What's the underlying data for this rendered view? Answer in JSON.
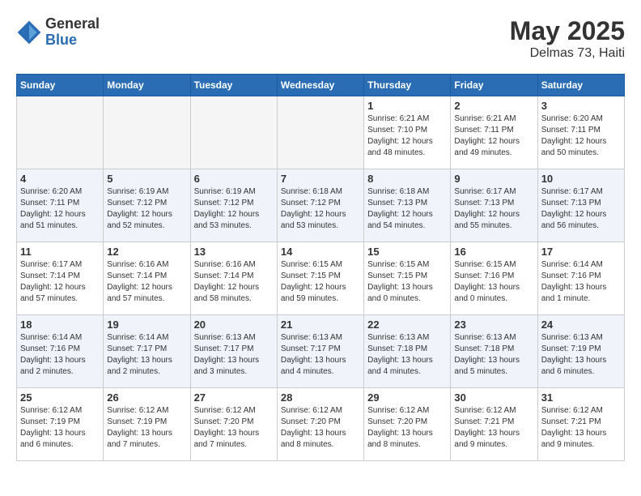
{
  "header": {
    "logo_general": "General",
    "logo_blue": "Blue",
    "title": "May 2025",
    "location": "Delmas 73, Haiti"
  },
  "weekdays": [
    "Sunday",
    "Monday",
    "Tuesday",
    "Wednesday",
    "Thursday",
    "Friday",
    "Saturday"
  ],
  "weeks": [
    [
      {
        "day": "",
        "sunrise": "",
        "sunset": "",
        "daylight": "",
        "empty": true
      },
      {
        "day": "",
        "sunrise": "",
        "sunset": "",
        "daylight": "",
        "empty": true
      },
      {
        "day": "",
        "sunrise": "",
        "sunset": "",
        "daylight": "",
        "empty": true
      },
      {
        "day": "",
        "sunrise": "",
        "sunset": "",
        "daylight": "",
        "empty": true
      },
      {
        "day": "1",
        "sunrise": "Sunrise: 6:21 AM",
        "sunset": "Sunset: 7:10 PM",
        "daylight": "Daylight: 12 hours and 48 minutes.",
        "empty": false
      },
      {
        "day": "2",
        "sunrise": "Sunrise: 6:21 AM",
        "sunset": "Sunset: 7:11 PM",
        "daylight": "Daylight: 12 hours and 49 minutes.",
        "empty": false
      },
      {
        "day": "3",
        "sunrise": "Sunrise: 6:20 AM",
        "sunset": "Sunset: 7:11 PM",
        "daylight": "Daylight: 12 hours and 50 minutes.",
        "empty": false
      }
    ],
    [
      {
        "day": "4",
        "sunrise": "Sunrise: 6:20 AM",
        "sunset": "Sunset: 7:11 PM",
        "daylight": "Daylight: 12 hours and 51 minutes.",
        "empty": false
      },
      {
        "day": "5",
        "sunrise": "Sunrise: 6:19 AM",
        "sunset": "Sunset: 7:12 PM",
        "daylight": "Daylight: 12 hours and 52 minutes.",
        "empty": false
      },
      {
        "day": "6",
        "sunrise": "Sunrise: 6:19 AM",
        "sunset": "Sunset: 7:12 PM",
        "daylight": "Daylight: 12 hours and 53 minutes.",
        "empty": false
      },
      {
        "day": "7",
        "sunrise": "Sunrise: 6:18 AM",
        "sunset": "Sunset: 7:12 PM",
        "daylight": "Daylight: 12 hours and 53 minutes.",
        "empty": false
      },
      {
        "day": "8",
        "sunrise": "Sunrise: 6:18 AM",
        "sunset": "Sunset: 7:13 PM",
        "daylight": "Daylight: 12 hours and 54 minutes.",
        "empty": false
      },
      {
        "day": "9",
        "sunrise": "Sunrise: 6:17 AM",
        "sunset": "Sunset: 7:13 PM",
        "daylight": "Daylight: 12 hours and 55 minutes.",
        "empty": false
      },
      {
        "day": "10",
        "sunrise": "Sunrise: 6:17 AM",
        "sunset": "Sunset: 7:13 PM",
        "daylight": "Daylight: 12 hours and 56 minutes.",
        "empty": false
      }
    ],
    [
      {
        "day": "11",
        "sunrise": "Sunrise: 6:17 AM",
        "sunset": "Sunset: 7:14 PM",
        "daylight": "Daylight: 12 hours and 57 minutes.",
        "empty": false
      },
      {
        "day": "12",
        "sunrise": "Sunrise: 6:16 AM",
        "sunset": "Sunset: 7:14 PM",
        "daylight": "Daylight: 12 hours and 57 minutes.",
        "empty": false
      },
      {
        "day": "13",
        "sunrise": "Sunrise: 6:16 AM",
        "sunset": "Sunset: 7:14 PM",
        "daylight": "Daylight: 12 hours and 58 minutes.",
        "empty": false
      },
      {
        "day": "14",
        "sunrise": "Sunrise: 6:15 AM",
        "sunset": "Sunset: 7:15 PM",
        "daylight": "Daylight: 12 hours and 59 minutes.",
        "empty": false
      },
      {
        "day": "15",
        "sunrise": "Sunrise: 6:15 AM",
        "sunset": "Sunset: 7:15 PM",
        "daylight": "Daylight: 13 hours and 0 minutes.",
        "empty": false
      },
      {
        "day": "16",
        "sunrise": "Sunrise: 6:15 AM",
        "sunset": "Sunset: 7:16 PM",
        "daylight": "Daylight: 13 hours and 0 minutes.",
        "empty": false
      },
      {
        "day": "17",
        "sunrise": "Sunrise: 6:14 AM",
        "sunset": "Sunset: 7:16 PM",
        "daylight": "Daylight: 13 hours and 1 minute.",
        "empty": false
      }
    ],
    [
      {
        "day": "18",
        "sunrise": "Sunrise: 6:14 AM",
        "sunset": "Sunset: 7:16 PM",
        "daylight": "Daylight: 13 hours and 2 minutes.",
        "empty": false
      },
      {
        "day": "19",
        "sunrise": "Sunrise: 6:14 AM",
        "sunset": "Sunset: 7:17 PM",
        "daylight": "Daylight: 13 hours and 2 minutes.",
        "empty": false
      },
      {
        "day": "20",
        "sunrise": "Sunrise: 6:13 AM",
        "sunset": "Sunset: 7:17 PM",
        "daylight": "Daylight: 13 hours and 3 minutes.",
        "empty": false
      },
      {
        "day": "21",
        "sunrise": "Sunrise: 6:13 AM",
        "sunset": "Sunset: 7:17 PM",
        "daylight": "Daylight: 13 hours and 4 minutes.",
        "empty": false
      },
      {
        "day": "22",
        "sunrise": "Sunrise: 6:13 AM",
        "sunset": "Sunset: 7:18 PM",
        "daylight": "Daylight: 13 hours and 4 minutes.",
        "empty": false
      },
      {
        "day": "23",
        "sunrise": "Sunrise: 6:13 AM",
        "sunset": "Sunset: 7:18 PM",
        "daylight": "Daylight: 13 hours and 5 minutes.",
        "empty": false
      },
      {
        "day": "24",
        "sunrise": "Sunrise: 6:13 AM",
        "sunset": "Sunset: 7:19 PM",
        "daylight": "Daylight: 13 hours and 6 minutes.",
        "empty": false
      }
    ],
    [
      {
        "day": "25",
        "sunrise": "Sunrise: 6:12 AM",
        "sunset": "Sunset: 7:19 PM",
        "daylight": "Daylight: 13 hours and 6 minutes.",
        "empty": false
      },
      {
        "day": "26",
        "sunrise": "Sunrise: 6:12 AM",
        "sunset": "Sunset: 7:19 PM",
        "daylight": "Daylight: 13 hours and 7 minutes.",
        "empty": false
      },
      {
        "day": "27",
        "sunrise": "Sunrise: 6:12 AM",
        "sunset": "Sunset: 7:20 PM",
        "daylight": "Daylight: 13 hours and 7 minutes.",
        "empty": false
      },
      {
        "day": "28",
        "sunrise": "Sunrise: 6:12 AM",
        "sunset": "Sunset: 7:20 PM",
        "daylight": "Daylight: 13 hours and 8 minutes.",
        "empty": false
      },
      {
        "day": "29",
        "sunrise": "Sunrise: 6:12 AM",
        "sunset": "Sunset: 7:20 PM",
        "daylight": "Daylight: 13 hours and 8 minutes.",
        "empty": false
      },
      {
        "day": "30",
        "sunrise": "Sunrise: 6:12 AM",
        "sunset": "Sunset: 7:21 PM",
        "daylight": "Daylight: 13 hours and 9 minutes.",
        "empty": false
      },
      {
        "day": "31",
        "sunrise": "Sunrise: 6:12 AM",
        "sunset": "Sunset: 7:21 PM",
        "daylight": "Daylight: 13 hours and 9 minutes.",
        "empty": false
      }
    ]
  ]
}
